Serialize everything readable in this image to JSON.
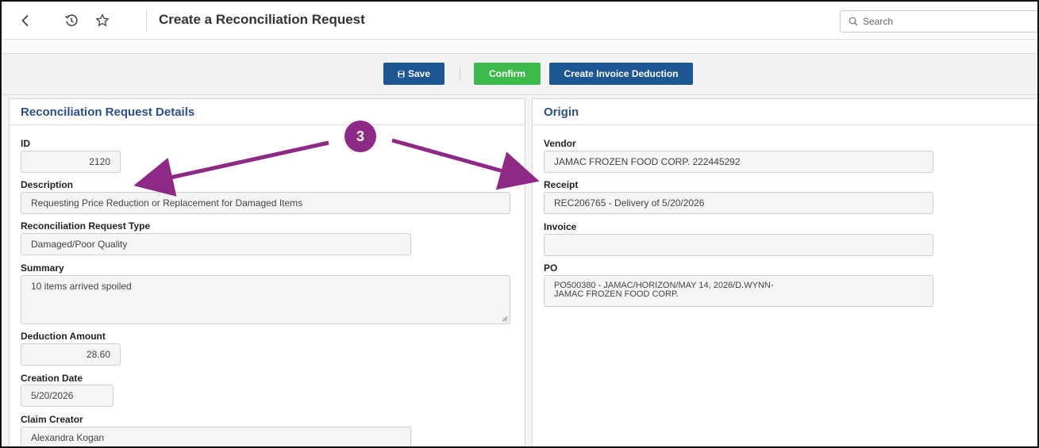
{
  "header": {
    "title": "Create a Reconciliation Request",
    "search_placeholder": "Search"
  },
  "toolbar": {
    "save_label": "Save",
    "confirm_label": "Confirm",
    "deduction_label": "Create Invoice Deduction"
  },
  "details": {
    "title": "Reconciliation Request Details",
    "id_label": "ID",
    "id_value": "2120",
    "description_label": "Description",
    "description_value": "Requesting Price Reduction or Replacement for Damaged Items",
    "type_label": "Reconciliation Request Type",
    "type_value": "Damaged/Poor Quality",
    "summary_label": "Summary",
    "summary_value": "10 items arrived spoiled",
    "deduction_label": "Deduction Amount",
    "deduction_value": "28.60",
    "creation_date_label": "Creation Date",
    "creation_date_value": "5/20/2026",
    "creator_label": "Claim Creator",
    "creator_value": "Alexandra Kogan"
  },
  "origin": {
    "title": "Origin",
    "vendor_label": "Vendor",
    "vendor_value": "JAMAC FROZEN FOOD CORP. 222445292",
    "receipt_label": "Receipt",
    "receipt_value": "REC206765 - Delivery of 5/20/2026",
    "invoice_label": "Invoice",
    "invoice_value": "",
    "po_label": "PO",
    "po_line1": "PO500380 - JAMAC/HORIZON/MAY 14, 2026/D.WYNN-",
    "po_line2": "JAMAC FROZEN FOOD CORP."
  },
  "annotation": {
    "step_number": "3",
    "color": "#8e2a86"
  },
  "colors": {
    "primary": "#1c5794",
    "confirm": "#3dbb4a",
    "panel_title": "#2d4f8a"
  }
}
